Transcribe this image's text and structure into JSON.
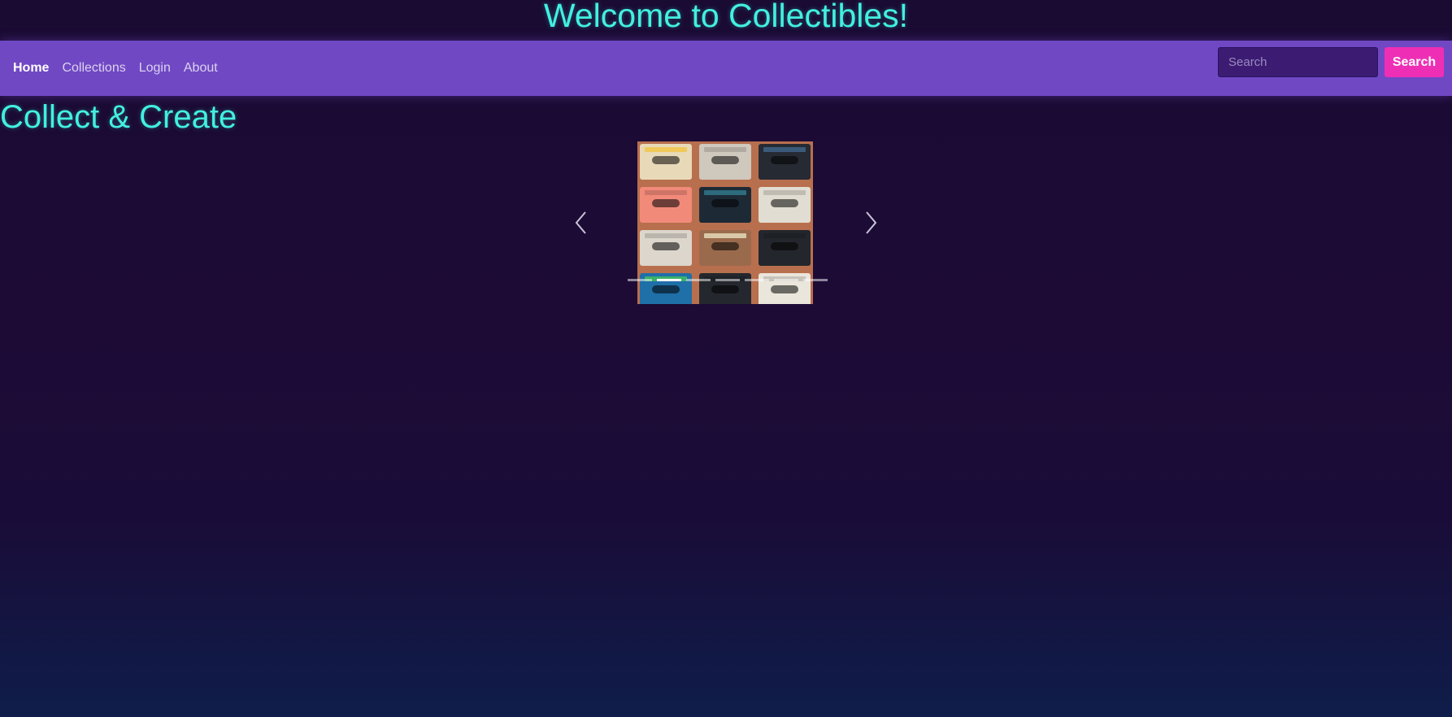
{
  "header": {
    "title": "Welcome to Collectibles!"
  },
  "nav": {
    "items": [
      {
        "label": "Home",
        "active": true
      },
      {
        "label": "Collections",
        "active": false
      },
      {
        "label": "Login",
        "active": false
      },
      {
        "label": "About",
        "active": false
      }
    ],
    "search": {
      "placeholder": "Search",
      "value": "",
      "button_label": "Search"
    }
  },
  "main": {
    "heading": "Collect & Create",
    "carousel": {
      "active_slide": 2,
      "slide_count": 7,
      "image_icon": "cassette-tapes-photo",
      "prev_icon": "chevron-left-icon",
      "next_icon": "chevron-right-icon"
    }
  },
  "colors": {
    "accent_heading": "#42f0e0",
    "navbar_bg": "#7048c4",
    "search_button_bg": "#ee2fb5",
    "page_bg_top": "#1a0b33",
    "page_bg_bottom": "#0f1d4a"
  }
}
